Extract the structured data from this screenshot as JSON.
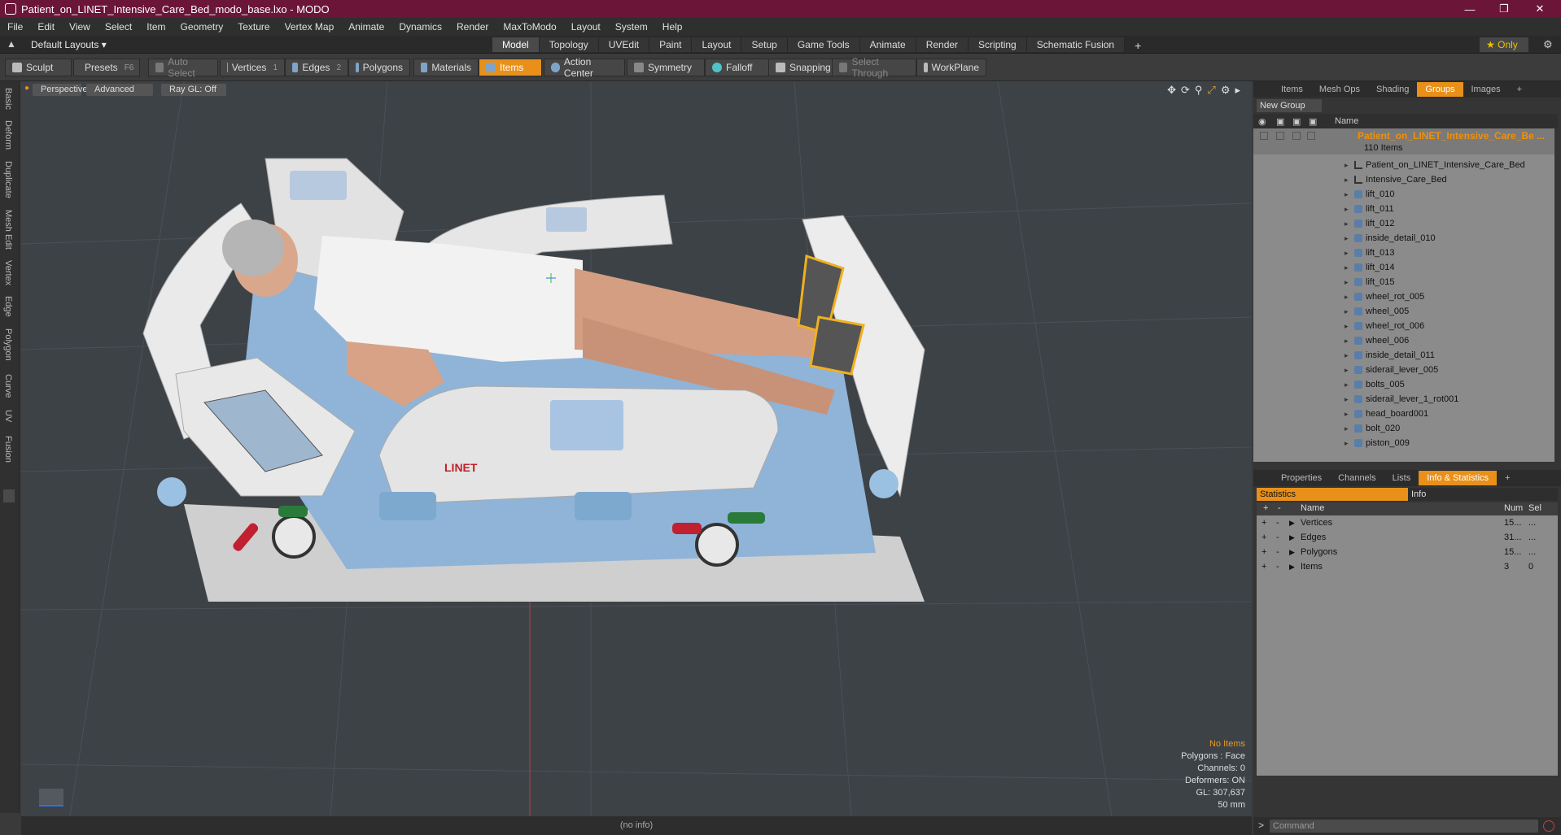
{
  "window": {
    "title": "Patient_on_LINET_Intensive_Care_Bed_modo_base.lxo - MODO"
  },
  "menu": [
    "File",
    "Edit",
    "View",
    "Select",
    "Item",
    "Geometry",
    "Texture",
    "Vertex Map",
    "Animate",
    "Dynamics",
    "Render",
    "MaxToModo",
    "Layout",
    "System",
    "Help"
  ],
  "layout": {
    "name": "Default Layouts",
    "tabs": [
      "Model",
      "Topology",
      "UVEdit",
      "Paint",
      "Layout",
      "Setup",
      "Game Tools",
      "Animate",
      "Render",
      "Scripting",
      "Schematic Fusion"
    ],
    "active_tab": "Model",
    "only": "Only"
  },
  "toolbar": {
    "sculpt": "Sculpt",
    "presets": "Presets",
    "presets_key": "F6",
    "auto_select": "Auto Select",
    "vertices": "Vertices",
    "vertices_n": "1",
    "edges": "Edges",
    "edges_n": "2",
    "polygons": "Polygons",
    "materials": "Materials",
    "items": "Items",
    "action_center": "Action Center",
    "symmetry": "Symmetry",
    "falloff": "Falloff",
    "snapping": "Snapping",
    "select_through": "Select Through",
    "workplane": "WorkPlane"
  },
  "left_tabs": [
    "Basic",
    "Deform",
    "Duplicate",
    "Mesh Edit",
    "Vertex",
    "Edge",
    "Polygon",
    "Curve",
    "UV",
    "Fusion"
  ],
  "viewport": {
    "perspective": "Perspective",
    "advanced": "Advanced",
    "raygl": "Ray GL: Off",
    "stats": {
      "no_items": "No Items",
      "polygons": "Polygons : Face",
      "channels": "Channels: 0",
      "deformers": "Deformers: ON",
      "gl": "GL: 307,637",
      "scale": "50 mm"
    },
    "brand": "LINET"
  },
  "status": {
    "info": "(no info)"
  },
  "right_top_tabs": [
    "Items",
    "Mesh Ops",
    "Shading",
    "Groups",
    "Images"
  ],
  "right_top_active": "Groups",
  "groups": {
    "new_group": "New Group",
    "col_name": "Name",
    "group_name": "Patient_on_LINET_Intensive_Care_Be ...",
    "count": "110 Items",
    "items": [
      "Patient_on_LINET_Intensive_Care_Bed",
      "Intensive_Care_Bed",
      "lift_010",
      "lift_011",
      "lift_012",
      "inside_detail_010",
      "lift_013",
      "lift_014",
      "lift_015",
      "wheel_rot_005",
      "wheel_005",
      "wheel_rot_006",
      "wheel_006",
      "inside_detail_011",
      "siderail_lever_005",
      "bolts_005",
      "siderail_lever_1_rot001",
      "head_board001",
      "bolt_020",
      "piston_009"
    ]
  },
  "right_bottom_tabs": [
    "Properties",
    "Channels",
    "Lists",
    "Info & Statistics"
  ],
  "right_bottom_active": "Info & Statistics",
  "info": {
    "statistics": "Statistics",
    "info": "Info",
    "col_name": "Name",
    "col_num": "Num",
    "col_sel": "Sel",
    "rows": [
      {
        "name": "Vertices",
        "num": "15...",
        "sel": "..."
      },
      {
        "name": "Edges",
        "num": "31...",
        "sel": "..."
      },
      {
        "name": "Polygons",
        "num": "15...",
        "sel": "..."
      },
      {
        "name": "Items",
        "num": "3",
        "sel": "0"
      }
    ]
  },
  "command": {
    "placeholder": "Command"
  }
}
